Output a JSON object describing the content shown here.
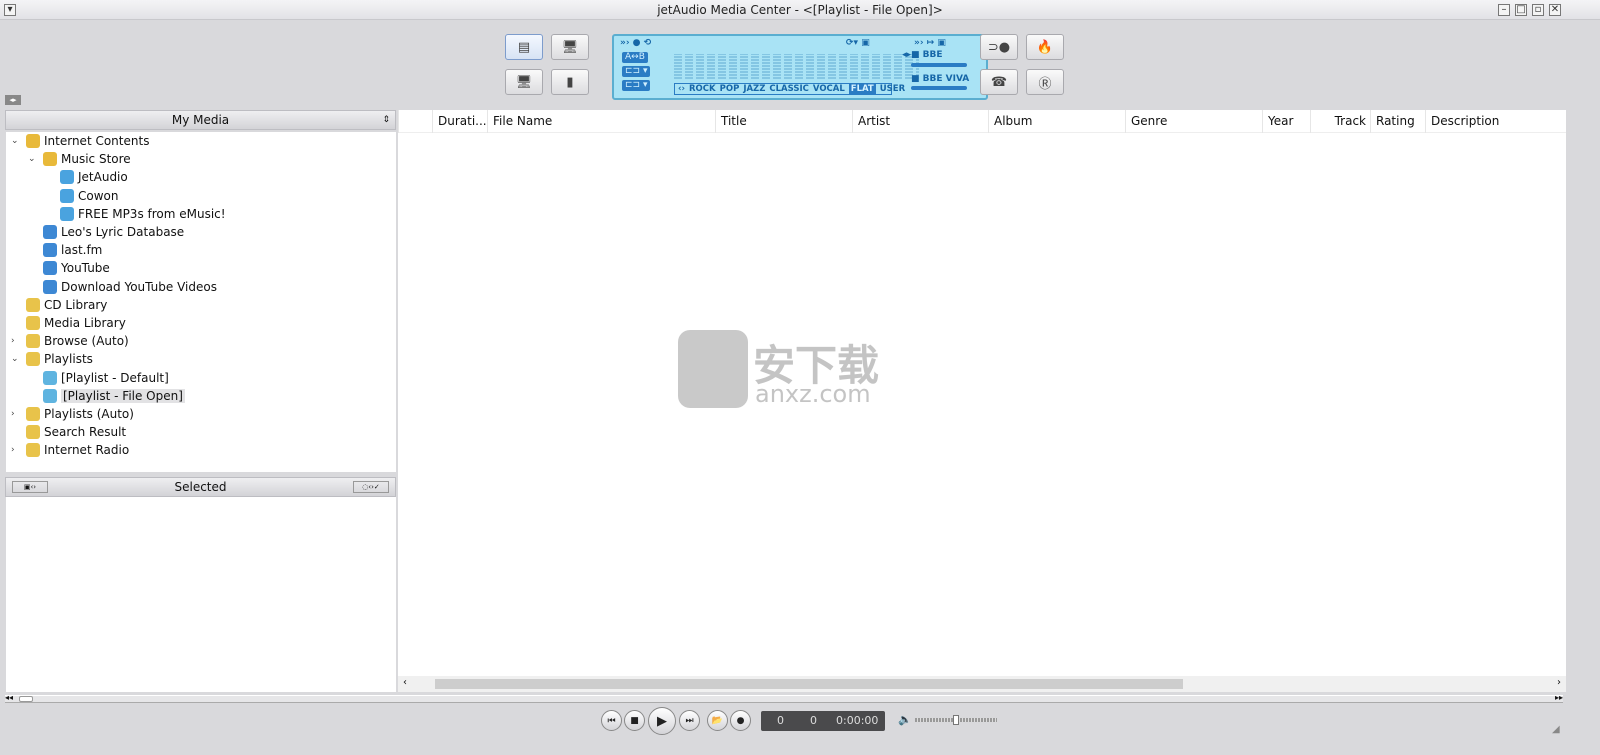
{
  "window": {
    "title": "jetAudio Media Center - <[Playlist - File Open]>"
  },
  "lcd": {
    "ab_label": "A↔B",
    "eq_presets": [
      "ROCK",
      "POP",
      "JAZZ",
      "CLASSIC",
      "VOCAL",
      "FLAT",
      "USER"
    ],
    "eq_selected": "FLAT",
    "bbe_label": "BBE",
    "bbe_viva_label": "BBE VIVA",
    "bbe_level": 0.45,
    "viva_level": 0.45
  },
  "left_panel": {
    "title": "My Media",
    "tree": [
      {
        "label": "Internet Contents",
        "level": 0,
        "expander": "open",
        "icon": "globe-folder-icon",
        "color": "#e8b93a"
      },
      {
        "label": "Music Store",
        "level": 1,
        "expander": "open",
        "icon": "store-folder-icon",
        "color": "#e8b93a"
      },
      {
        "label": "JetAudio",
        "level": 2,
        "icon": "music-store-icon",
        "color": "#4aa3df"
      },
      {
        "label": "Cowon",
        "level": 2,
        "icon": "music-store-icon",
        "color": "#4aa3df"
      },
      {
        "label": "FREE MP3s from eMusic!",
        "level": 2,
        "icon": "music-store-icon",
        "color": "#4aa3df"
      },
      {
        "label": "Leo's Lyric Database",
        "level": 1,
        "icon": "globe-icon",
        "color": "#3d88d4"
      },
      {
        "label": "last.fm",
        "level": 1,
        "icon": "globe-icon",
        "color": "#3d88d4"
      },
      {
        "label": "YouTube",
        "level": 1,
        "icon": "globe-icon",
        "color": "#3d88d4"
      },
      {
        "label": "Download YouTube Videos",
        "level": 1,
        "icon": "globe-icon",
        "color": "#3d88d4"
      },
      {
        "label": "CD Library",
        "level": 0,
        "icon": "cd-folder-icon",
        "color": "#e8c34a"
      },
      {
        "label": "Media Library",
        "level": 0,
        "icon": "library-folder-icon",
        "color": "#e8c34a"
      },
      {
        "label": "Browse (Auto)",
        "level": 0,
        "expander": "closed",
        "icon": "browse-folder-icon",
        "color": "#e8c34a"
      },
      {
        "label": "Playlists",
        "level": 0,
        "expander": "open",
        "icon": "playlist-folder-icon",
        "color": "#e8c34a"
      },
      {
        "label": "[Playlist - Default]",
        "level": 1,
        "icon": "playlist-icon",
        "color": "#5fb4e0"
      },
      {
        "label": "[Playlist - File Open]",
        "level": 1,
        "icon": "playlist-icon",
        "color": "#5fb4e0",
        "selected": true
      },
      {
        "label": "Playlists (Auto)",
        "level": 0,
        "expander": "closed",
        "icon": "auto-playlist-folder-icon",
        "color": "#e8c34a"
      },
      {
        "label": "Search Result",
        "level": 0,
        "icon": "search-folder-icon",
        "color": "#e8c34a"
      },
      {
        "label": "Internet Radio",
        "level": 0,
        "expander": "closed",
        "icon": "radio-folder-icon",
        "color": "#e8c34a"
      }
    ],
    "selected_title": "Selected"
  },
  "list": {
    "columns": [
      "",
      "Durati...",
      "File Name",
      "Title",
      "Artist",
      "Album",
      "Genre",
      "Year",
      "Track",
      "Rating",
      "Description"
    ]
  },
  "watermark": {
    "text": "安下载",
    "sub": "anxz.com"
  },
  "player": {
    "counter1": "0",
    "counter2": "0",
    "time": "0:00:00",
    "volume": 0.5
  }
}
